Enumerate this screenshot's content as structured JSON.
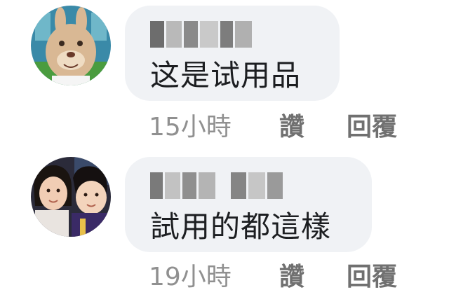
{
  "comments": [
    {
      "text": "这是试用品",
      "time": "15小時",
      "like_label": "讚",
      "reply_label": "回覆"
    },
    {
      "text": "試用的都這樣",
      "time": "19小時",
      "like_label": "讚",
      "reply_label": "回覆"
    }
  ],
  "colors": {
    "bubble_bg": "#f0f2f5",
    "text": "#1c1e21",
    "meta_text": "#909090"
  }
}
